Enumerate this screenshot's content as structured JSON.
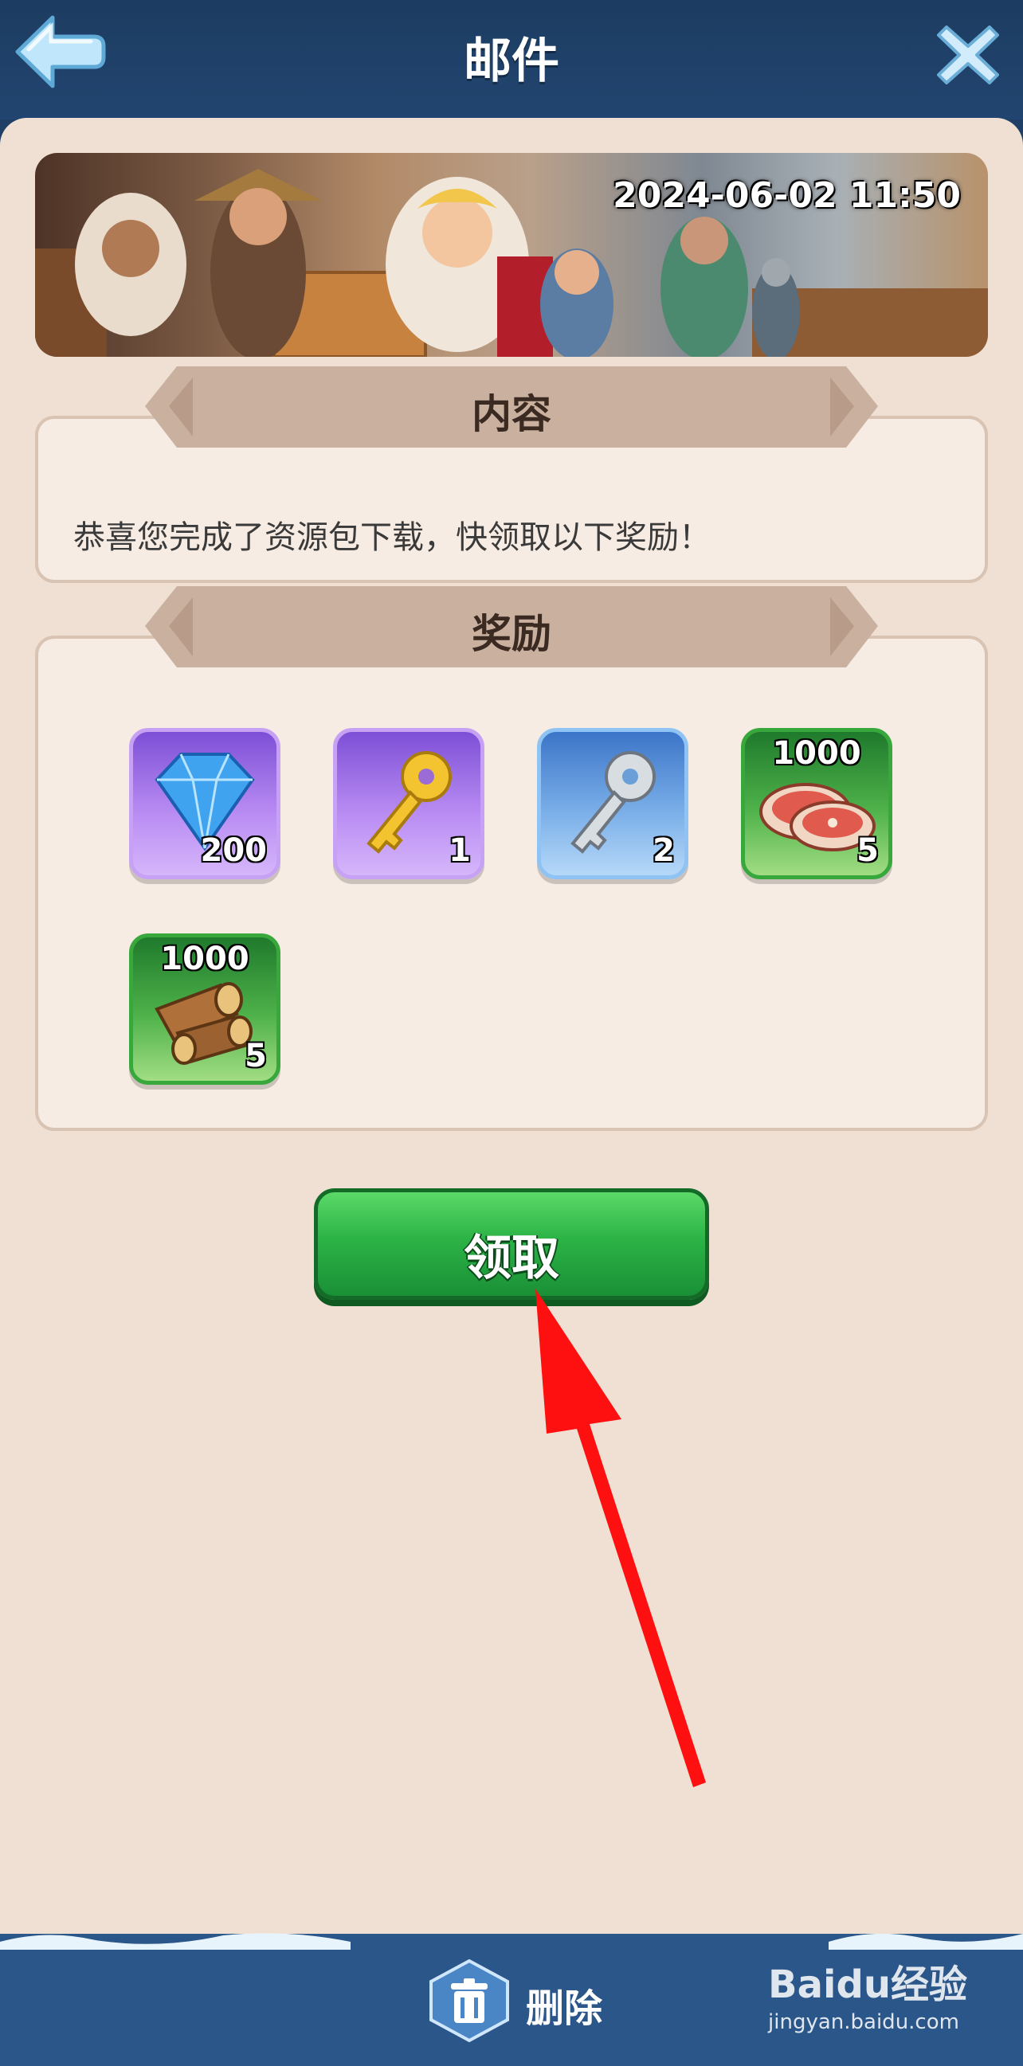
{
  "header": {
    "title": "邮件",
    "back_icon": "back-arrow-icon",
    "close_icon": "close-icon"
  },
  "banner": {
    "date": "2024-06-02 11:50"
  },
  "content_section": {
    "tab_label": "内容",
    "text": "恭喜您完成了资源包下载，快领取以下奖励！"
  },
  "rewards_section": {
    "tab_label": "奖励",
    "items": [
      {
        "icon": "diamond-icon",
        "quantity": "200",
        "tier": "purple"
      },
      {
        "icon": "gold-key-icon",
        "quantity": "1",
        "tier": "purple"
      },
      {
        "icon": "silver-key-icon",
        "quantity": "2",
        "tier": "blue"
      },
      {
        "icon": "meat-icon",
        "amount": "1000",
        "quantity": "5",
        "tier": "green"
      },
      {
        "icon": "wood-icon",
        "amount": "1000",
        "quantity": "5",
        "tier": "green"
      }
    ]
  },
  "claim_button": {
    "label": "领取"
  },
  "annotation": {
    "icon": "red-arrow-icon",
    "color": "#ff1010"
  },
  "footer": {
    "delete_label": "删除",
    "delete_icon": "trash-icon",
    "watermark_brand": "Baidu经验",
    "watermark_url": "jingyan.baidu.com"
  },
  "colors": {
    "header_bg": "#1f3f66",
    "panel_bg": "#f0e0d3",
    "claim_button": "#2cb346",
    "footer_bg": "#2b5689"
  }
}
